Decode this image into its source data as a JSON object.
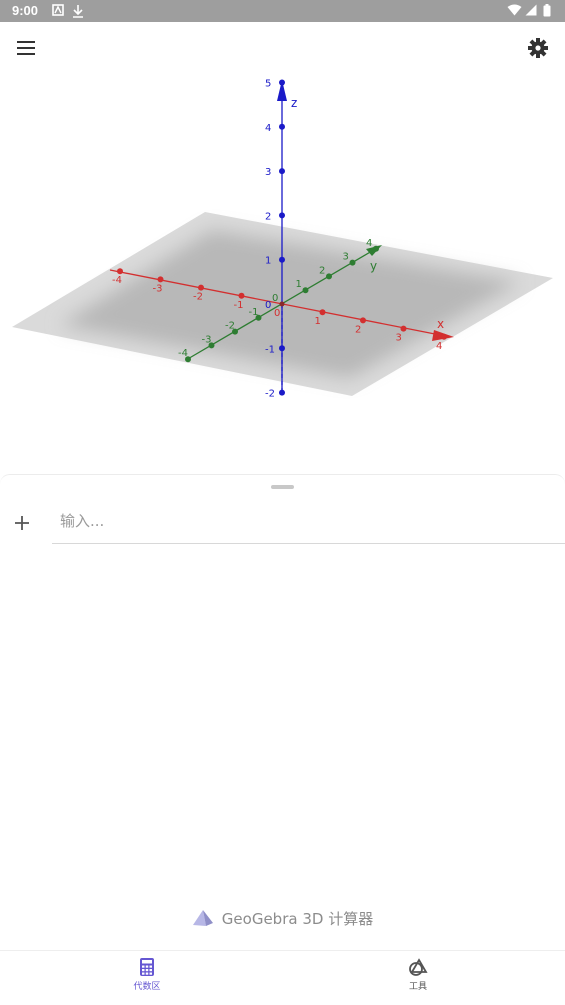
{
  "status_bar": {
    "time": "9:00"
  },
  "graphics_view": {
    "axes": {
      "x": {
        "label": "x",
        "color": "#d32f2f",
        "ticks": [
          "-4",
          "-3",
          "-2",
          "-1",
          "0",
          "1",
          "2",
          "3",
          "4"
        ]
      },
      "y": {
        "label": "y",
        "color": "#2e7d32",
        "ticks": [
          "-4",
          "-3",
          "-2",
          "-1",
          "0",
          "1",
          "2",
          "3",
          "4"
        ]
      },
      "z": {
        "label": "z",
        "color": "#1a1ac8",
        "ticks": [
          "-2",
          "-1",
          "0",
          "1",
          "2",
          "3",
          "4",
          "5"
        ]
      }
    }
  },
  "algebra": {
    "input_placeholder": "输入..."
  },
  "branding": {
    "text": "GeoGebra 3D 计算器"
  },
  "bottom_nav": {
    "algebra_label": "代数区",
    "tools_label": "工具",
    "active_color": "#6557d2",
    "inactive_color": "#666666"
  }
}
